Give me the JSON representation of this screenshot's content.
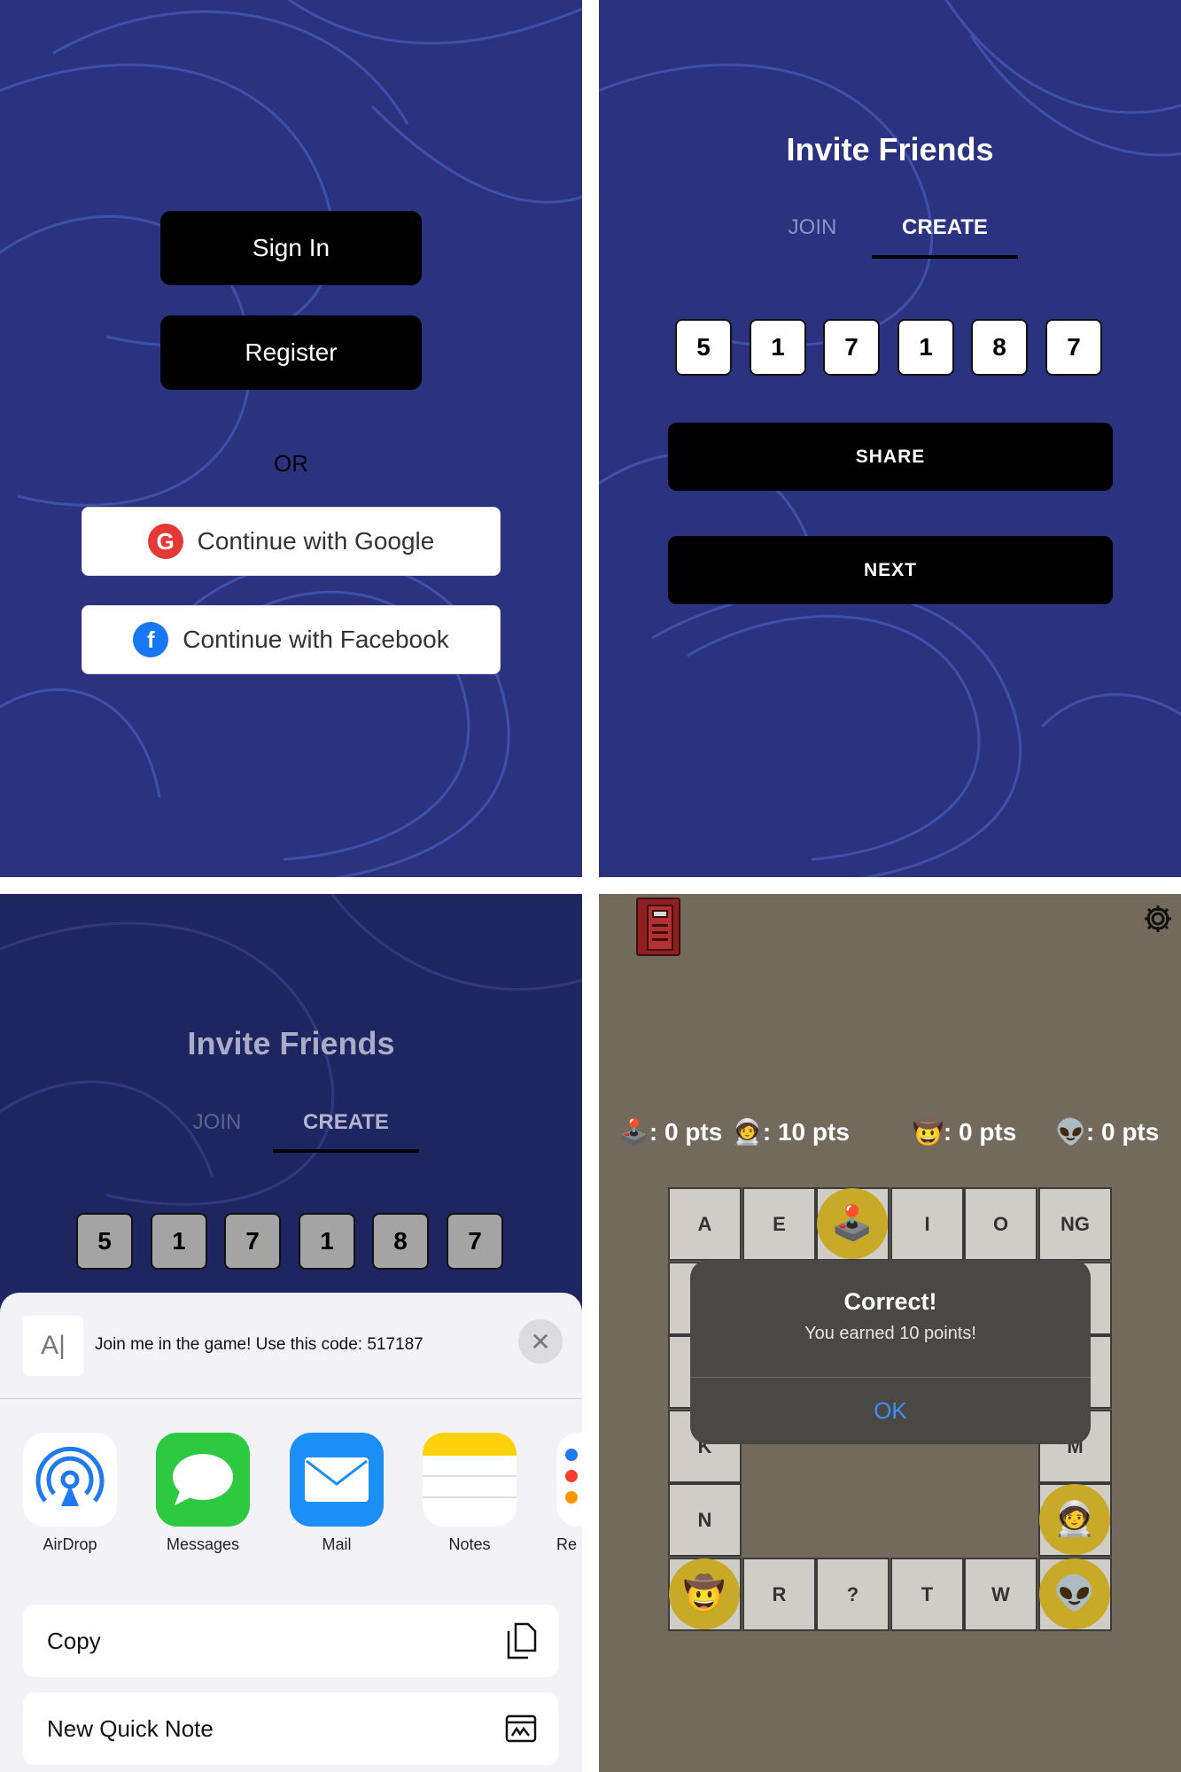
{
  "auth": {
    "sign_in": "Sign In",
    "register": "Register",
    "or": "OR",
    "google": "Continue with Google",
    "facebook": "Continue with Facebook"
  },
  "invite": {
    "title": "Invite Friends",
    "tab_join": "JOIN",
    "tab_create": "CREATE",
    "code": [
      "5",
      "1",
      "7",
      "1",
      "8",
      "7"
    ],
    "share": "SHARE",
    "next": "NEXT"
  },
  "share_sheet": {
    "message": "Join me in the game! Use this code: 517187",
    "apps": [
      "AirDrop",
      "Messages",
      "Mail",
      "Notes",
      "Re"
    ],
    "actions": [
      "Copy",
      "New Quick Note"
    ]
  },
  "game": {
    "scores": [
      {
        "icon": "🕹️",
        "text": ": 0 pts"
      },
      {
        "icon": "🧑‍🚀",
        "text": ": 10 pts"
      },
      {
        "icon": "🤠",
        "text": ": 0 pts"
      },
      {
        "icon": "👽",
        "text": ": 0 pts"
      }
    ],
    "top_row": [
      "A",
      "E",
      "",
      "I",
      "O",
      "NG"
    ],
    "left_col": [
      "",
      "",
      "K",
      "N"
    ],
    "right_col": [
      "",
      "",
      "M",
      ""
    ],
    "bottom_row": [
      "",
      "R",
      "?",
      "T",
      "W",
      ""
    ],
    "alert": {
      "title": "Correct!",
      "message": "You earned 10 points!",
      "ok": "OK"
    }
  },
  "colors": {
    "brand_bg": "#2b3380",
    "game_bg": "#736a5d",
    "token": "#c9a928",
    "ios_blue": "#3478f6"
  }
}
